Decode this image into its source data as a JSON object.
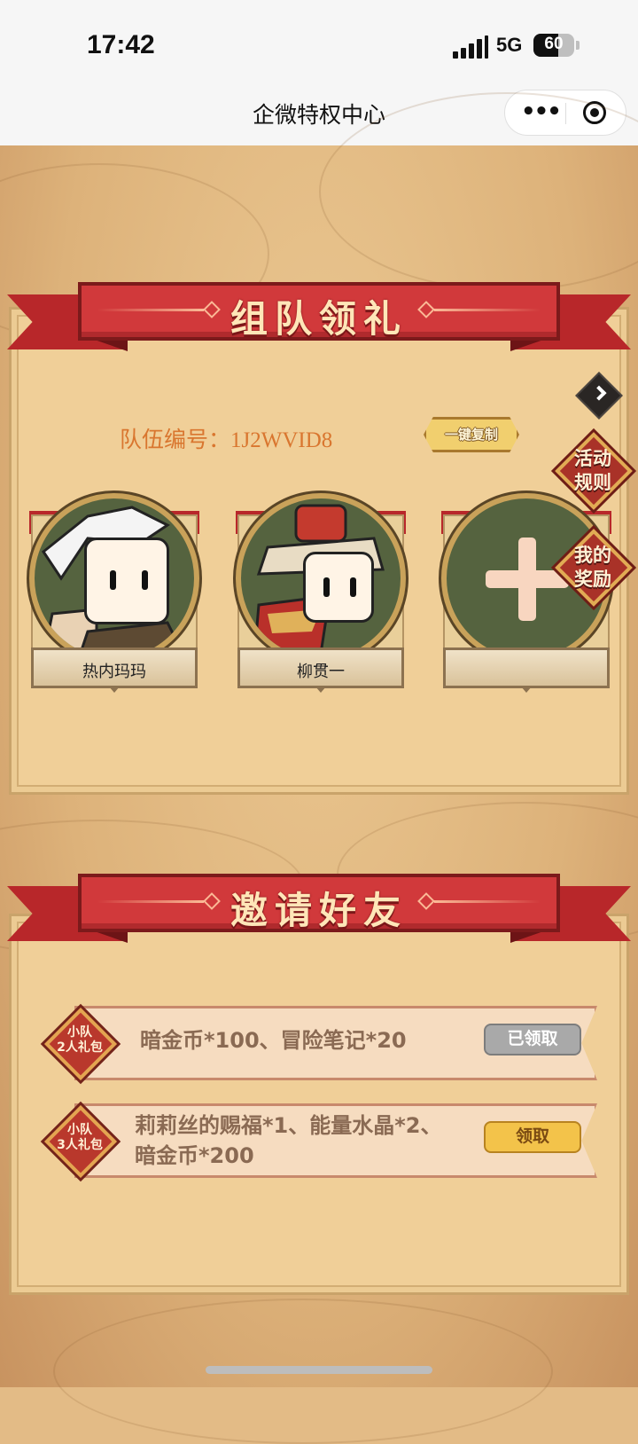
{
  "status_bar": {
    "time": "17:42",
    "network": "5G",
    "battery": "60",
    "battery_level": 0.6
  },
  "nav": {
    "title": "企微特权中心"
  },
  "team_section": {
    "title": "组队领礼",
    "team_id_label": "队伍编号：",
    "team_id_value": "1J2WVID8",
    "copy_button": "一键复制",
    "members": [
      {
        "name": "热内玛玛"
      },
      {
        "name": "柳贯一"
      },
      {
        "name": ""
      }
    ]
  },
  "side_buttons": {
    "rules": [
      "活动",
      "规则"
    ],
    "my_rewards": [
      "我的",
      "奖励"
    ]
  },
  "invite_section": {
    "title": "邀请好友",
    "rewards": [
      {
        "badge": [
          "小队",
          "2人礼包"
        ],
        "desc_line1": "暗金币*100、冒险笔记*20",
        "desc_line2": "",
        "button": "已领取",
        "state": "claimed"
      },
      {
        "badge": [
          "小队",
          "3人礼包"
        ],
        "desc_line1": "莉莉丝的赐福*1、能量水晶*2、",
        "desc_line2": "暗金币*200",
        "button": "领取",
        "state": "available"
      }
    ]
  }
}
